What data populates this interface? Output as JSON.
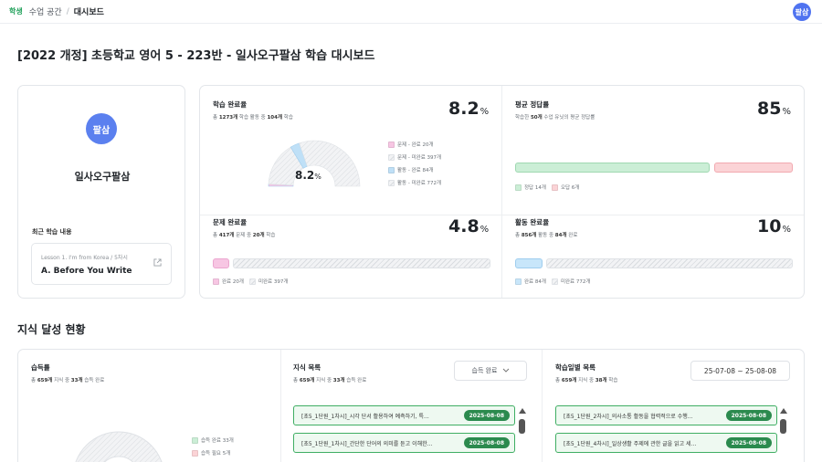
{
  "breadcrumb": {
    "badge": "학생",
    "items": [
      "수업 공간",
      "대시보드"
    ],
    "sep": "/"
  },
  "user": {
    "avatar": "팔삼"
  },
  "page_title": "[2022 개정] 초등학교 영어 5 - 223반 - 일사오구팔삼 학습 대시보드",
  "profile": {
    "avatar": "팔삼",
    "name": "일사오구팔삼",
    "recent_label": "최근 학습 내용",
    "recent_sub": "Lesson 1. I'm from Korea / 5차시",
    "recent_title": "A. Before You Write"
  },
  "completion": {
    "title": "학습 완료율",
    "sub_pre": "총 ",
    "sub_a": "1273개",
    "sub_mid": " 학습 활동 중 ",
    "sub_b": "104개",
    "sub_post": " 학습",
    "value": "8.2",
    "unit": "%",
    "gauge_label": "8.2",
    "gauge_unit": "%",
    "legend": [
      "문제 - 완료 20개",
      "문제 - 미완료 397개",
      "활동 - 완료 84개",
      "활동 - 미완료 772개"
    ],
    "parts": [
      20,
      397,
      84,
      772
    ],
    "colors": [
      "#f7c6e3",
      "#e9ebee",
      "#bfe0f7",
      "#e9ebee"
    ]
  },
  "accuracy": {
    "title": "평균 정답률",
    "sub_pre": "학습한 ",
    "sub_a": "50개",
    "sub_post": " 수업 유닛의 평균 정답률",
    "value": "85",
    "unit": "%",
    "correct": 14,
    "wrong": 6,
    "legend": [
      "정답 14개",
      "오답 6개"
    ],
    "colors": [
      "#cbeed6",
      "#fbd3d6"
    ]
  },
  "problems": {
    "title": "문제 완료율",
    "sub_pre": "총 ",
    "sub_a": "417개",
    "sub_mid": " 문제 중 ",
    "sub_b": "20개",
    "sub_post": " 학습",
    "value": "4.8",
    "unit": "%",
    "done": 20,
    "todo": 397,
    "legend": [
      "완료 20개",
      "미완료 397개"
    ],
    "color": "#f7c6e3"
  },
  "activities": {
    "title": "활동 완료율",
    "sub_pre": "총 ",
    "sub_a": "856개",
    "sub_mid": " 활동 중 ",
    "sub_b": "84개",
    "sub_post": " 완료",
    "value": "10",
    "unit": "%",
    "done": 84,
    "todo": 772,
    "legend": [
      "완료 84개",
      "미완료 772개"
    ],
    "color": "#c8e6fa"
  },
  "knowledge": {
    "section_title": "지식 달성 현황",
    "mastery": {
      "title": "습득률",
      "sub_pre": "총 ",
      "sub_a": "659개",
      "sub_mid": " 지식 중 ",
      "sub_b": "33개",
      "sub_post": " 습득 완료",
      "legend": [
        "습득 완료 33개",
        "습득 필요 5개"
      ],
      "colors": [
        "#cbeed6",
        "#fbd3d6"
      ]
    },
    "list": {
      "title": "지식 목록",
      "sub_pre": "총 ",
      "sub_a": "659개",
      "sub_mid": " 지식 중 ",
      "sub_b": "33개",
      "sub_post": " 습득 완료",
      "filter": "습득 완료",
      "items": [
        {
          "text": "[초5_1단원_1차시]_시각 단서 활용하여 예측하기, 특...",
          "date": "2025-08-08"
        },
        {
          "text": "[초5_1단원_1차시]_간단한 단어의 의미를 듣고 이해한...",
          "date": "2025-08-08"
        }
      ]
    },
    "daily": {
      "title": "학습일별 목록",
      "sub_pre": "총 ",
      "sub_a": "659개",
      "sub_mid": " 지식 중 ",
      "sub_b": "38개",
      "sub_post": " 학습",
      "range": "25-07-08 ~ 25-08-08",
      "items": [
        {
          "text": "[초5_1단원_2차시]_의사소통 활동을 협력적으로 수행...",
          "date": "2025-08-08"
        },
        {
          "text": "[초5_1단원_4차시]_일상생활 주제에 관한 글을 읽고 세...",
          "date": "2025-08-08"
        }
      ]
    }
  },
  "icons": {
    "external": "external-link-icon",
    "chevron": "chevron-down-icon",
    "scroll_up": "arrow-up-icon"
  }
}
